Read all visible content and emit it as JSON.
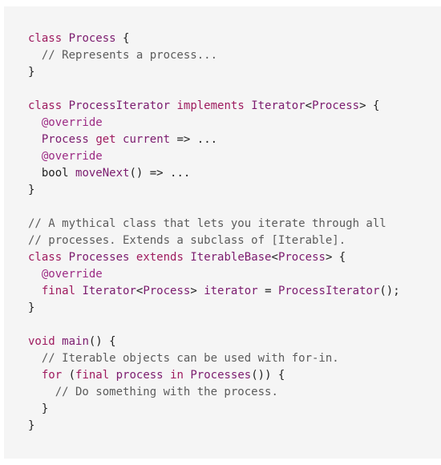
{
  "code": {
    "lines": [
      [
        [
          "keyword",
          "class"
        ],
        [
          "plain",
          " "
        ],
        [
          "type",
          "Process"
        ],
        [
          "plain",
          " {"
        ]
      ],
      [
        [
          "plain",
          "  "
        ],
        [
          "comment",
          "// Represents a process..."
        ]
      ],
      [
        [
          "plain",
          "}"
        ]
      ],
      [],
      [
        [
          "keyword",
          "class"
        ],
        [
          "plain",
          " "
        ],
        [
          "type",
          "ProcessIterator"
        ],
        [
          "plain",
          " "
        ],
        [
          "keyword",
          "implements"
        ],
        [
          "plain",
          " "
        ],
        [
          "type",
          "Iterator"
        ],
        [
          "plain",
          "<"
        ],
        [
          "type",
          "Process"
        ],
        [
          "plain",
          "> {"
        ]
      ],
      [
        [
          "plain",
          "  "
        ],
        [
          "annotation",
          "@override"
        ]
      ],
      [
        [
          "plain",
          "  "
        ],
        [
          "type",
          "Process"
        ],
        [
          "plain",
          " "
        ],
        [
          "keyword",
          "get"
        ],
        [
          "plain",
          " "
        ],
        [
          "type",
          "current"
        ],
        [
          "plain",
          " => ..."
        ]
      ],
      [
        [
          "plain",
          "  "
        ],
        [
          "annotation",
          "@override"
        ]
      ],
      [
        [
          "plain",
          "  bool "
        ],
        [
          "type",
          "moveNext"
        ],
        [
          "plain",
          "() => ..."
        ]
      ],
      [
        [
          "plain",
          "}"
        ]
      ],
      [],
      [
        [
          "comment",
          "// A mythical class that lets you iterate through all"
        ]
      ],
      [
        [
          "comment",
          "// processes. Extends a subclass of [Iterable]."
        ]
      ],
      [
        [
          "keyword",
          "class"
        ],
        [
          "plain",
          " "
        ],
        [
          "type",
          "Processes"
        ],
        [
          "plain",
          " "
        ],
        [
          "keyword",
          "extends"
        ],
        [
          "plain",
          " "
        ],
        [
          "type",
          "IterableBase"
        ],
        [
          "plain",
          "<"
        ],
        [
          "type",
          "Process"
        ],
        [
          "plain",
          "> {"
        ]
      ],
      [
        [
          "plain",
          "  "
        ],
        [
          "annotation",
          "@override"
        ]
      ],
      [
        [
          "plain",
          "  "
        ],
        [
          "keyword",
          "final"
        ],
        [
          "plain",
          " "
        ],
        [
          "type",
          "Iterator"
        ],
        [
          "plain",
          "<"
        ],
        [
          "type",
          "Process"
        ],
        [
          "plain",
          "> "
        ],
        [
          "type",
          "iterator"
        ],
        [
          "plain",
          " = "
        ],
        [
          "type",
          "ProcessIterator"
        ],
        [
          "plain",
          "();"
        ]
      ],
      [
        [
          "plain",
          "}"
        ]
      ],
      [],
      [
        [
          "keyword",
          "void"
        ],
        [
          "plain",
          " "
        ],
        [
          "type",
          "main"
        ],
        [
          "plain",
          "() {"
        ]
      ],
      [
        [
          "plain",
          "  "
        ],
        [
          "comment",
          "// Iterable objects can be used with for-in."
        ]
      ],
      [
        [
          "plain",
          "  "
        ],
        [
          "keyword",
          "for"
        ],
        [
          "plain",
          " ("
        ],
        [
          "keyword",
          "final"
        ],
        [
          "plain",
          " "
        ],
        [
          "type",
          "process"
        ],
        [
          "plain",
          " "
        ],
        [
          "keyword",
          "in"
        ],
        [
          "plain",
          " "
        ],
        [
          "type",
          "Processes"
        ],
        [
          "plain",
          "()) {"
        ]
      ],
      [
        [
          "plain",
          "    "
        ],
        [
          "comment",
          "// Do something with the process."
        ]
      ],
      [
        [
          "plain",
          "  }"
        ]
      ],
      [
        [
          "plain",
          "}"
        ]
      ]
    ]
  }
}
